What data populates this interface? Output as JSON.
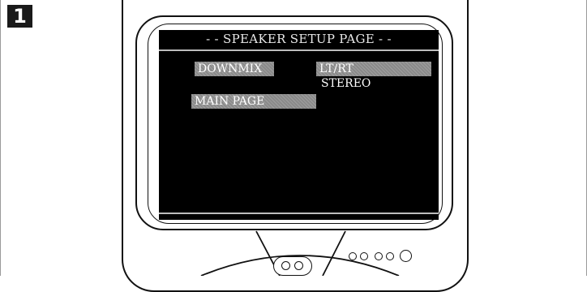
{
  "step": {
    "number": "1"
  },
  "screen": {
    "title": "- - SPEAKER SETUP PAGE - -",
    "menu": {
      "downmix_label": "DOWNMIX",
      "main_page_label": "MAIN PAGE"
    },
    "options": {
      "selected": "LT/RT",
      "other": "STEREO"
    }
  },
  "controls": {
    "icons": [
      "power-button-icon",
      "small-button-icon",
      "small-button-icon",
      "small-button-icon",
      "small-button-icon",
      "large-button-icon"
    ]
  }
}
